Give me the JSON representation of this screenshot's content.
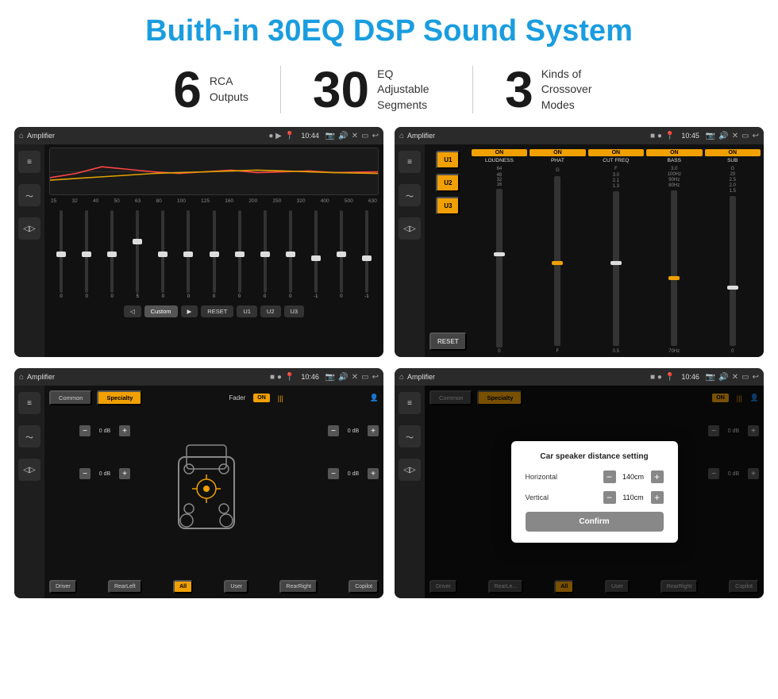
{
  "title": "Buith-in 30EQ DSP Sound System",
  "stats": [
    {
      "number": "6",
      "text": "RCA\nOutputs"
    },
    {
      "number": "30",
      "text": "EQ Adjustable\nSegments"
    },
    {
      "number": "3",
      "text": "Kinds of\nCrossover Modes"
    }
  ],
  "screen1": {
    "app": "Amplifier",
    "time": "10:44",
    "freqs": [
      "25",
      "32",
      "40",
      "50",
      "63",
      "80",
      "100",
      "125",
      "160",
      "200",
      "250",
      "320",
      "400",
      "500",
      "630"
    ],
    "slider_values": [
      "0",
      "0",
      "0",
      "5",
      "0",
      "0",
      "0",
      "0",
      "0",
      "0",
      "-1",
      "0",
      "-1"
    ],
    "preset_buttons": [
      "Custom",
      "RESET",
      "U1",
      "U2",
      "U3"
    ]
  },
  "screen2": {
    "app": "Amplifier",
    "time": "10:45",
    "presets": [
      "U1",
      "U2",
      "U3"
    ],
    "channels": [
      "LOUDNESS",
      "PHAT",
      "CUT FREQ",
      "BASS",
      "SUB"
    ],
    "reset": "RESET"
  },
  "screen3": {
    "app": "Amplifier",
    "time": "10:46",
    "tab1": "Common",
    "tab2": "Specialty",
    "fader_label": "Fader",
    "on_label": "ON",
    "channel_rows": [
      {
        "value": "0 dB"
      },
      {
        "value": "0 dB"
      },
      {
        "value": "0 dB"
      },
      {
        "value": "0 dB"
      }
    ],
    "bottom_btns": [
      "Driver",
      "RearLeft",
      "All",
      "User",
      "RearRight",
      "Copilot"
    ]
  },
  "screen4": {
    "app": "Amplifier",
    "time": "10:46",
    "tab1": "Common",
    "tab2": "Specialty",
    "on_label": "ON",
    "dialog": {
      "title": "Car speaker distance setting",
      "horizontal_label": "Horizontal",
      "horizontal_value": "140cm",
      "vertical_label": "Vertical",
      "vertical_value": "110cm",
      "confirm_label": "Confirm"
    },
    "bottom_btns": [
      "Driver",
      "RearLeft",
      "All",
      "User",
      "RearRight",
      "Copilot"
    ]
  }
}
